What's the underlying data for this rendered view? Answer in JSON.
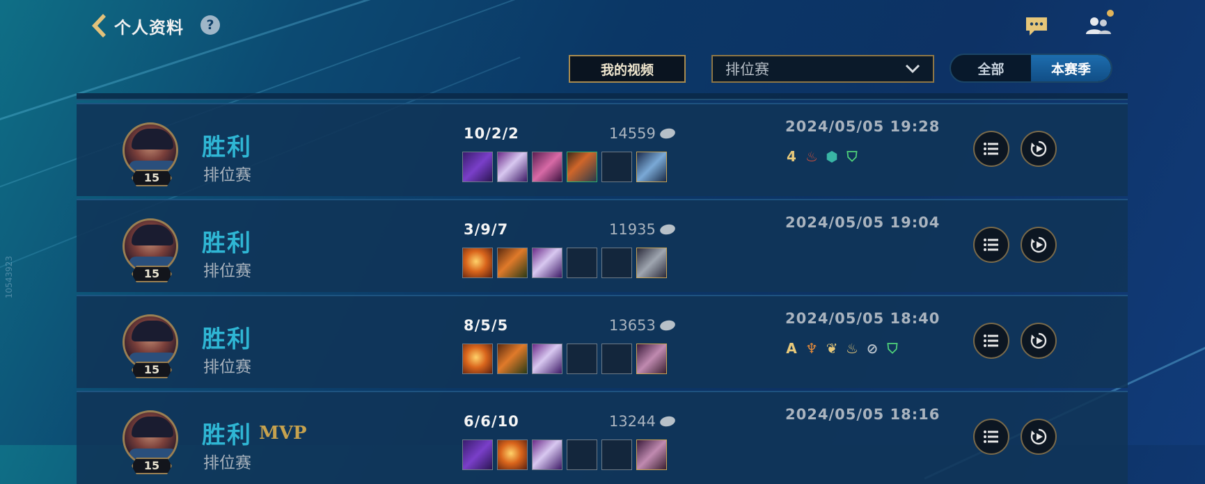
{
  "header": {
    "title": "个人资料",
    "help_label": "?"
  },
  "toolbar": {
    "video_button": "我的视频",
    "mode_select_value": "排位赛",
    "season_tabs": [
      {
        "label": "全部",
        "active": false
      },
      {
        "label": "本赛季",
        "active": true
      }
    ]
  },
  "watermark": "10543923",
  "matches": [
    {
      "level": "15",
      "result": "胜利",
      "mvp": "",
      "queue": "排位赛",
      "kda": "10/2/2",
      "gold": "14559",
      "items": [
        "i-purple",
        "i-sword",
        "i-pink",
        "i-armor",
        "",
        "i-ward"
      ],
      "datetime": "2024/05/05 19:28",
      "badges": [
        {
          "glyph": "4",
          "cls": "b-gold",
          "icon": "quadra-kill-icon"
        },
        {
          "glyph": "♨",
          "cls": "b-red",
          "icon": "flame-lotus-icon"
        },
        {
          "glyph": "⬢",
          "cls": "b-teal",
          "icon": "teal-shield-icon"
        },
        {
          "glyph": "⛉",
          "cls": "b-green",
          "icon": "green-shield-icon"
        }
      ]
    },
    {
      "level": "15",
      "result": "胜利",
      "mvp": "",
      "queue": "排位赛",
      "kda": "3/9/7",
      "gold": "11935",
      "items": [
        "i-orange",
        "i-red",
        "i-sword",
        "",
        "",
        "i-ward2"
      ],
      "datetime": "2024/05/05 19:04",
      "badges": []
    },
    {
      "level": "15",
      "result": "胜利",
      "mvp": "",
      "queue": "排位赛",
      "kda": "8/5/5",
      "gold": "13653",
      "items": [
        "i-orange",
        "i-red",
        "i-sword",
        "",
        "",
        "i-ward3"
      ],
      "datetime": "2024/05/05 18:40",
      "badges": [
        {
          "glyph": "A",
          "cls": "b-gold",
          "icon": "assist-icon"
        },
        {
          "glyph": "♆",
          "cls": "b-orange",
          "icon": "orange-crest-icon"
        },
        {
          "glyph": "❦",
          "cls": "b-gold",
          "icon": "leaf-crest-icon"
        },
        {
          "glyph": "♨",
          "cls": "b-gold",
          "icon": "fire-icon"
        },
        {
          "glyph": "⊘",
          "cls": "b-grey",
          "icon": "gear-badge-icon"
        },
        {
          "glyph": "⛉",
          "cls": "b-green",
          "icon": "green-shield-icon"
        }
      ]
    },
    {
      "level": "15",
      "result": "胜利",
      "mvp": "MVP",
      "queue": "排位赛",
      "kda": "6/6/10",
      "gold": "13244",
      "items": [
        "i-purple",
        "i-orange",
        "i-sword",
        "",
        "",
        "i-ward3"
      ],
      "datetime": "2024/05/05 18:16",
      "badges": []
    }
  ]
}
